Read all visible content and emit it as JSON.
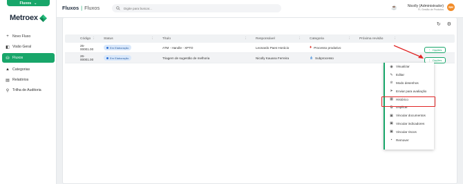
{
  "module": {
    "label": "Fluxos",
    "chevron": "chevron-down-icon"
  },
  "logo": {
    "text": "Metroex"
  },
  "sidebar": {
    "items": [
      {
        "label": "Novo Fluxo",
        "icon": "plus-icon",
        "active": false
      },
      {
        "label": "Visão Geral",
        "icon": "overview-icon",
        "active": false
      },
      {
        "label": "Fluxos",
        "icon": "flows-icon",
        "active": true
      },
      {
        "label": "Categorias",
        "icon": "categories-icon",
        "active": false
      },
      {
        "label": "Relatórios",
        "icon": "reports-icon",
        "active": false
      },
      {
        "label": "Trilha de Auditoria",
        "icon": "audit-icon",
        "active": false
      }
    ]
  },
  "header": {
    "breadcrumb_a": "Fluxos",
    "breadcrumb_sep": "|",
    "breadcrumb_b": "Fluxos",
    "search_placeholder": "Digite para buscar...",
    "user_name": "Nicolly (Administrador)",
    "user_role": "FL Gestão de Produtos",
    "avatar": "NH"
  },
  "table": {
    "columns": [
      "Código",
      "Status",
      "Título",
      "Responsável",
      "Categoria",
      "Próxima revisão"
    ],
    "rows": [
      {
        "codigo": "25-00001.00",
        "status": "Em Elaboração",
        "titulo": "ATM - Handle - XPTO",
        "responsavel": "Leonardo Paes Horácio",
        "categoria": "Processo produtivo",
        "categoria_icon": "flame-icon",
        "categoria_color": "#e0352b",
        "revisao": "",
        "options": "Opções"
      },
      {
        "codigo": "26-00001.00",
        "status": "Em Elaboração",
        "titulo": "Triagem de sugestão de melhoria",
        "responsavel": "Nicolly Kauana Ferreira",
        "categoria": "Subprocesso",
        "categoria_icon": "nodes-icon",
        "categoria_color": "#2b7fd6",
        "revisao": "",
        "options": "Opções"
      }
    ]
  },
  "menu": {
    "items": [
      {
        "label": "Visualizar",
        "icon": "eye-icon"
      },
      {
        "label": "Editar",
        "icon": "pencil-icon"
      },
      {
        "label": "Modo desenhos",
        "icon": "draw-icon"
      },
      {
        "label": "Enviar para avaliação",
        "icon": "send-icon"
      },
      {
        "label": "Histórico",
        "icon": "history-icon"
      },
      {
        "label": "Duplicar",
        "icon": "duplicate-icon"
      },
      {
        "label": "Vincular documentos",
        "icon": "link-doc-icon"
      },
      {
        "label": "Vincular indicadores",
        "icon": "link-indicator-icon"
      },
      {
        "label": "Vincular riscos",
        "icon": "link-risk-icon"
      },
      {
        "label": "Remover",
        "icon": "trash-icon"
      }
    ]
  },
  "colors": {
    "brand": "#18a66a",
    "annotation": "#e02424",
    "badge_bg": "#d9e8fb"
  }
}
